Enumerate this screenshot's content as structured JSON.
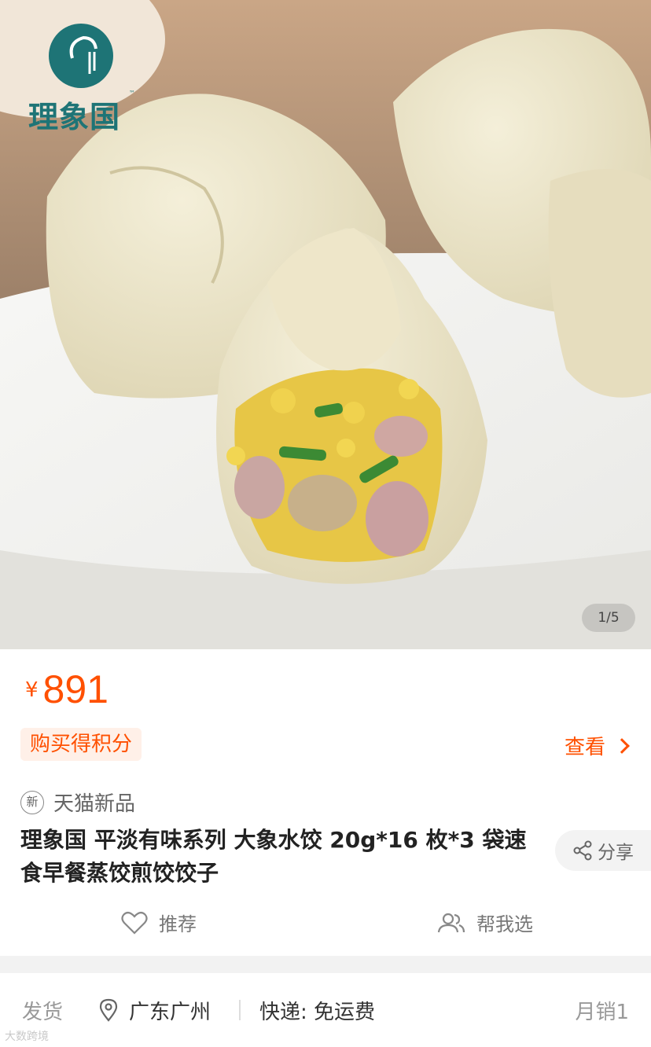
{
  "hero": {
    "brand_name": "理象国",
    "brand_tm": "™",
    "image_counter": "1/5"
  },
  "price": {
    "currency": "¥",
    "amount": "891"
  },
  "points": {
    "tag": "购买得积分",
    "view_label": "查看"
  },
  "product": {
    "badge_icon_text": "新",
    "badge_label": "天猫新品",
    "title": "理象国 平淡有味系列 大象水饺 20g*16 枚*3 袋速食早餐蒸饺煎饺饺子",
    "share_label": "分享"
  },
  "actions": {
    "recommend_label": "推荐",
    "help_choose_label": "帮我选"
  },
  "shipping": {
    "label": "发货",
    "location": "广东广州",
    "express": "快递: 免运费",
    "monthly_sales": "月销1"
  },
  "watermark": "大数跨境",
  "colors": {
    "accent": "#ff5000",
    "brand": "#1e7476",
    "points_bg": "#fff0e8"
  },
  "icons": [
    "heart-icon",
    "users-icon",
    "share-icon",
    "location-pin-icon",
    "chevron-right-icon"
  ]
}
